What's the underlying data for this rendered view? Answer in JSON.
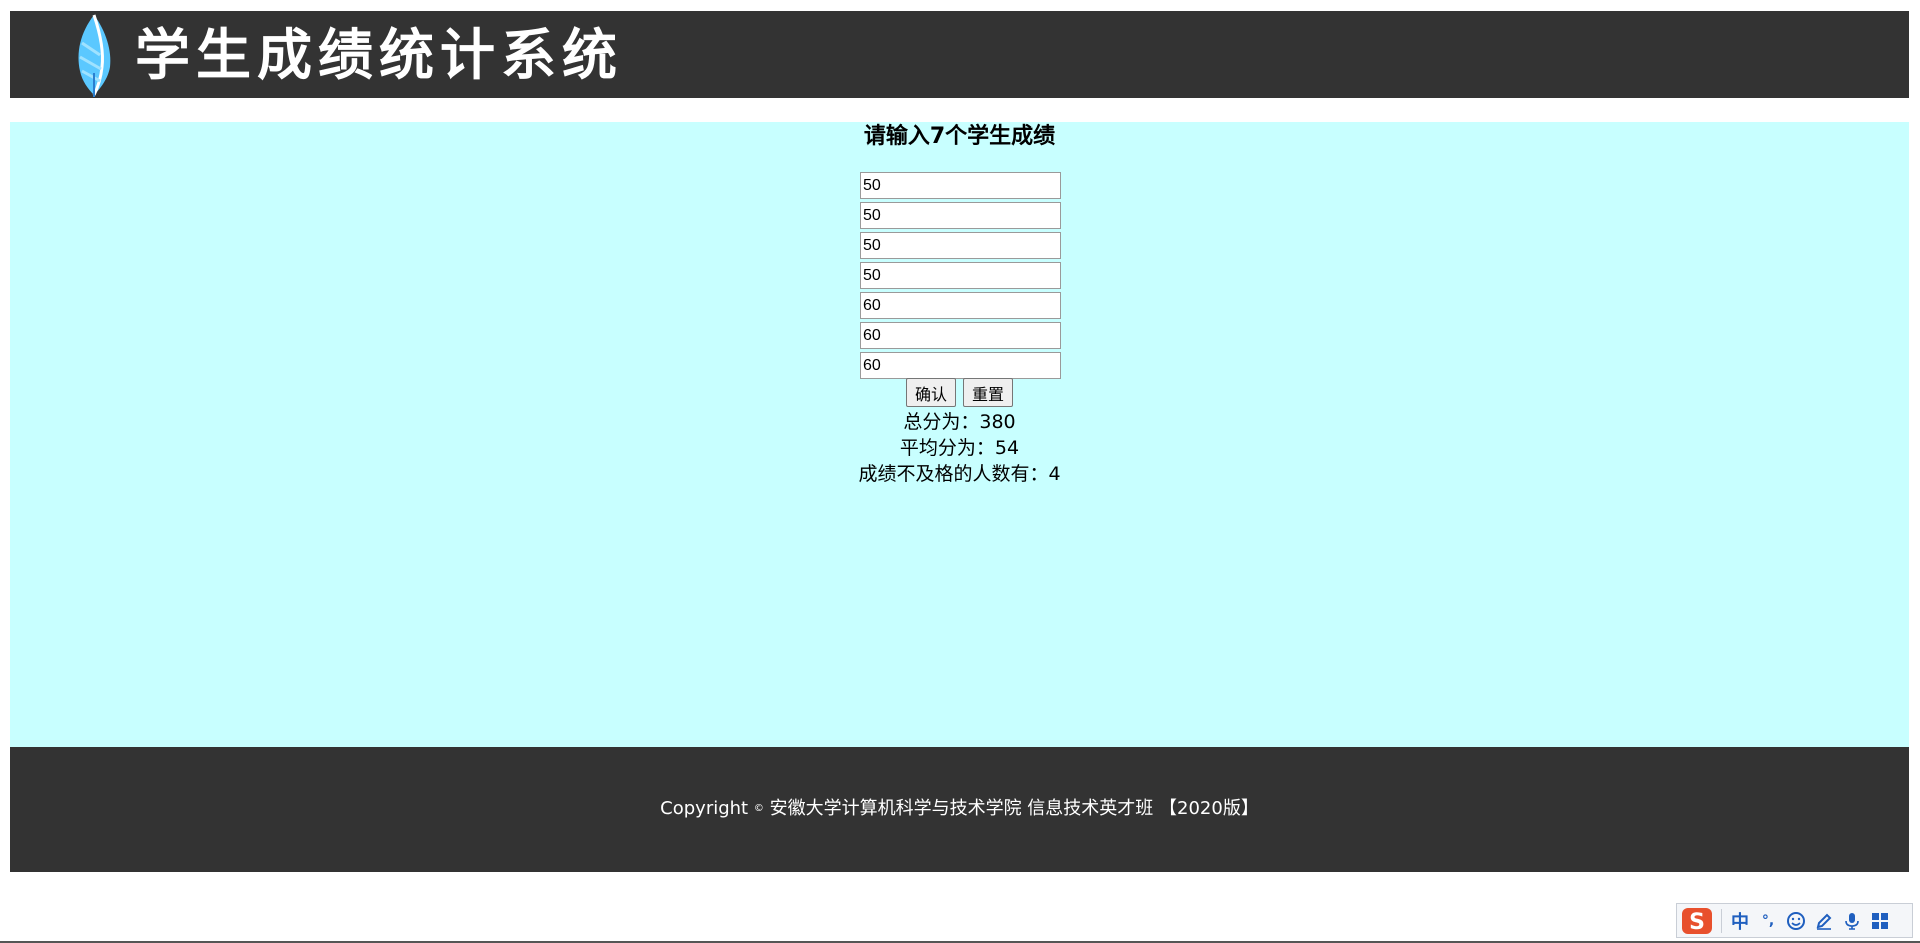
{
  "header": {
    "title": "学生成绩统计系统"
  },
  "form": {
    "title": "请输入7个学生成绩",
    "scores": [
      "50",
      "50",
      "50",
      "50",
      "60",
      "60",
      "60"
    ],
    "confirm_label": "确认",
    "reset_label": "重置"
  },
  "results": {
    "total_label": "总分为：",
    "total_value": "380",
    "average_label": "平均分为：",
    "average_value": "54",
    "fail_label": "成绩不及格的人数有：",
    "fail_value": "4"
  },
  "footer": {
    "copyright_word": "Copyright",
    "copyright_symbol": "©",
    "copyright_text": "安徽大学计算机科学与技术学院 信息技术英才班 【2020版】"
  },
  "ime_toolbar": {
    "lang_label": "中",
    "punct_label": "°,",
    "icons": [
      "sogou-logo-icon",
      "emoji-icon",
      "pen-icon",
      "microphone-icon",
      "grid-icon"
    ]
  },
  "colors": {
    "header_bg": "#333333",
    "main_bg": "#c8ffff",
    "footer_bg": "#333333",
    "feather_blue": "#5bc8ff",
    "ime_accent": "#e8502d"
  }
}
